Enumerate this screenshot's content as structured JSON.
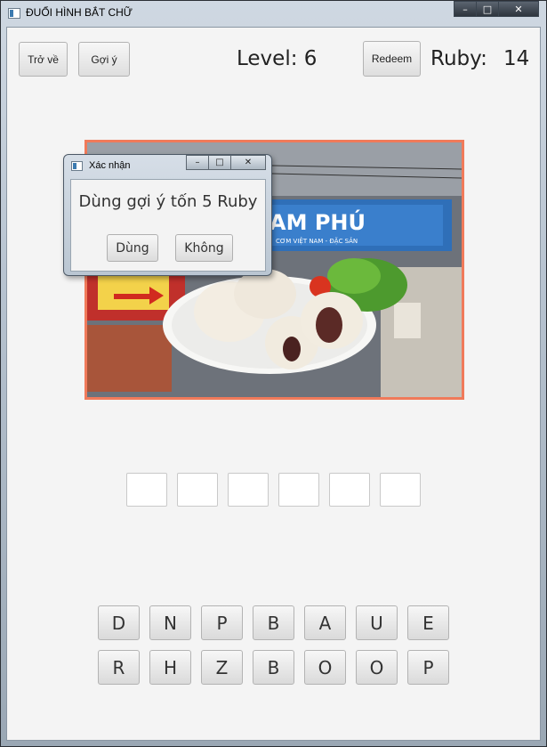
{
  "window": {
    "title": "ĐUỔI HÌNH BẮT CHỮ",
    "min": "–",
    "max": "□",
    "close": "✕"
  },
  "toolbar": {
    "back_label": "Trở về",
    "hint_label": "Gợi ý",
    "redeem_label": "Redeem"
  },
  "status": {
    "level_text": "Level: 6",
    "ruby_label": "Ruby:",
    "ruby_value": "14"
  },
  "picture": {
    "sign_text": "AM PHÚ",
    "sign_subtext": "CƠM VIỆT NAM - ĐẶC SẢN"
  },
  "answer_slots": [
    "",
    "",
    "",
    "",
    "",
    ""
  ],
  "letters_row1": [
    "D",
    "N",
    "P",
    "B",
    "A",
    "U",
    "E"
  ],
  "letters_row2": [
    "R",
    "H",
    "Z",
    "B",
    "O",
    "O",
    "P"
  ],
  "dialog": {
    "title": "Xác nhận",
    "message": "Dùng gợi ý tốn 5 Ruby",
    "confirm_label": "Dùng",
    "cancel_label": "Không"
  },
  "colors": {
    "picture_border": "#f07a5a",
    "sign_blue": "#2f6fb8"
  }
}
